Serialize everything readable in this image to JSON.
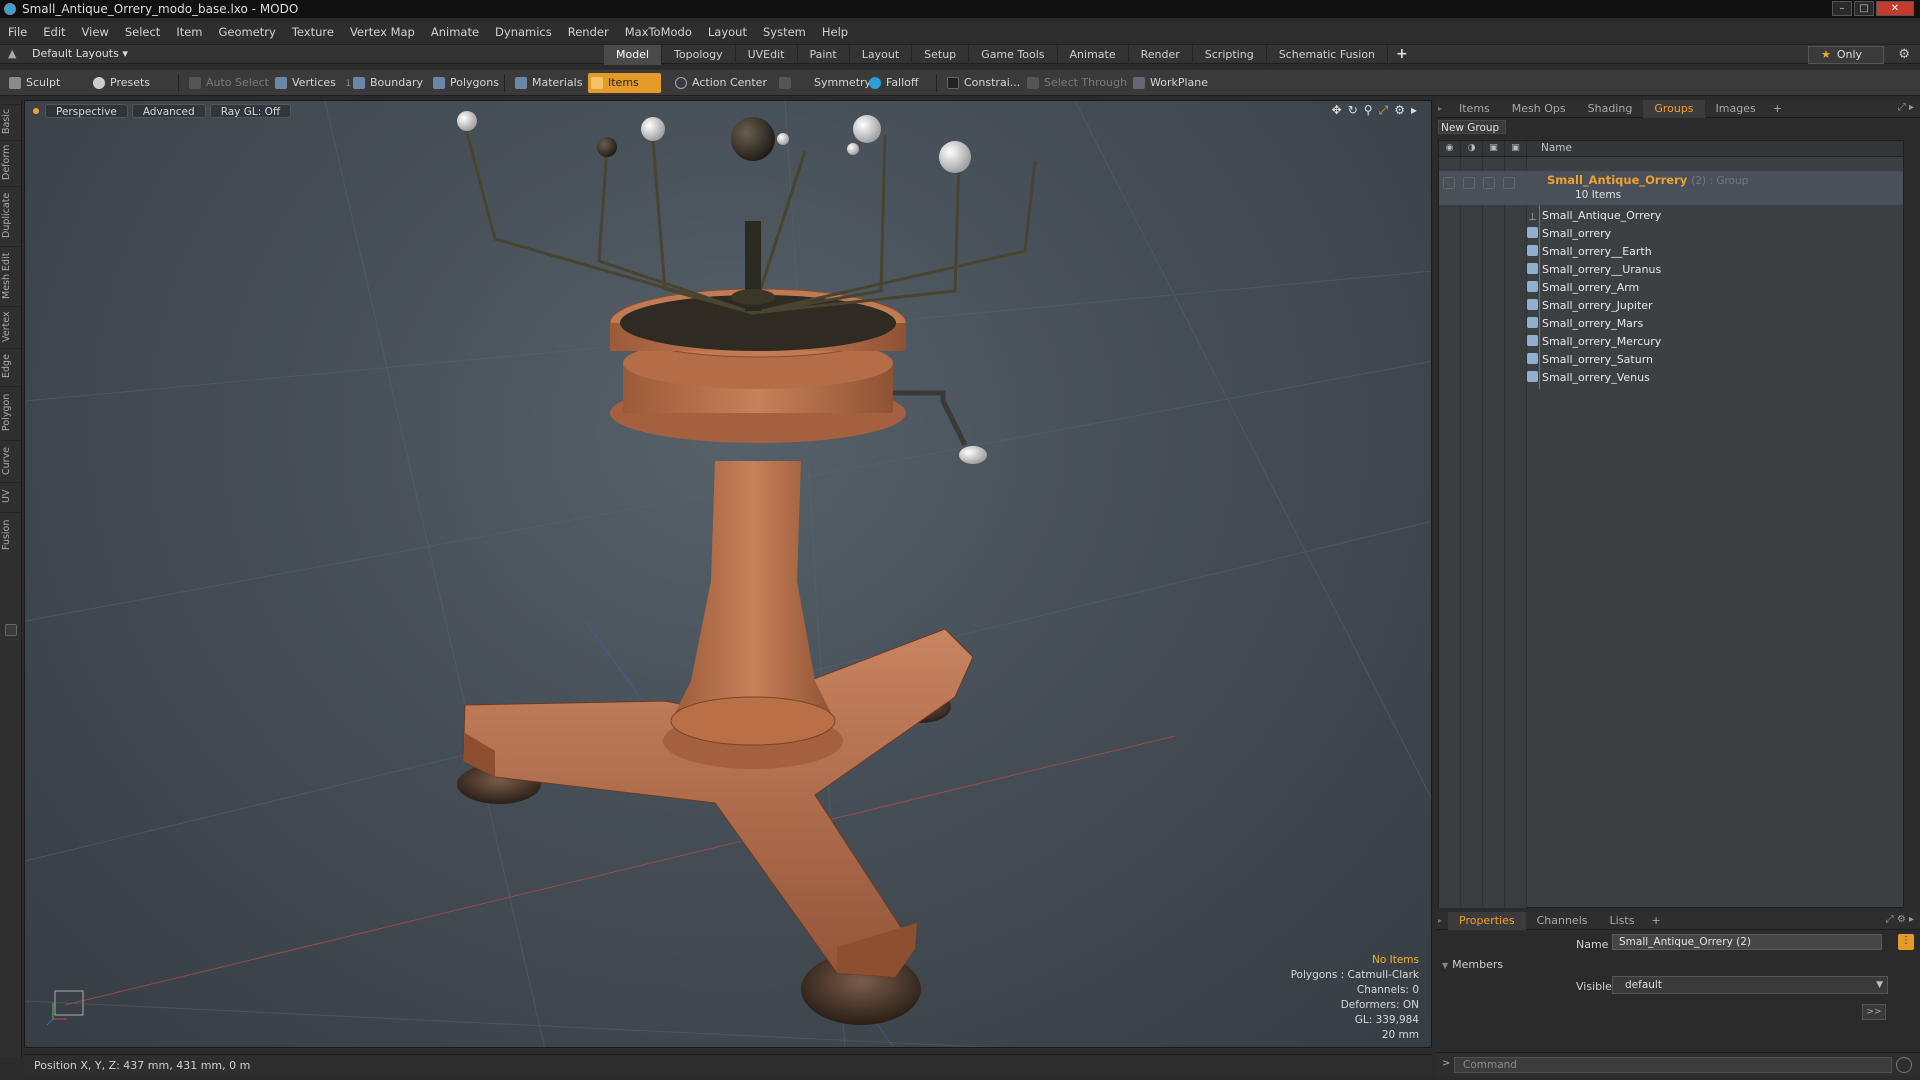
{
  "window": {
    "title": "Small_Antique_Orrery_modo_base.lxo - MODO"
  },
  "menu": [
    "File",
    "Edit",
    "View",
    "Select",
    "Item",
    "Geometry",
    "Texture",
    "Vertex Map",
    "Animate",
    "Dynamics",
    "Render",
    "MaxToModo",
    "Layout",
    "System",
    "Help"
  ],
  "layout": {
    "selector": "Default Layouts",
    "tabs": [
      "Model",
      "Topology",
      "UVEdit",
      "Paint",
      "Layout",
      "Setup",
      "Game Tools",
      "Animate",
      "Render",
      "Scripting",
      "Schematic Fusion"
    ],
    "active_tab": "Model",
    "only_label": "Only"
  },
  "toolbar": {
    "sculpt": "Sculpt",
    "presets": "Presets",
    "auto_select": "Auto Select",
    "vertices": "Vertices",
    "vertices_count": "1",
    "boundary": "Boundary",
    "polygons": "Polygons",
    "materials": "Materials",
    "items": "Items",
    "action_center": "Action Center",
    "symmetry": "Symmetry",
    "falloff": "Falloff",
    "constraints": "Constrai...",
    "select_through": "Select Through",
    "workplane": "WorkPlane"
  },
  "left_tabs": [
    "Basic",
    "Deform",
    "Duplicate",
    "Mesh Edit",
    "Vertex",
    "Edge",
    "Polygon",
    "Curve",
    "UV",
    "Fusion"
  ],
  "viewport": {
    "view": "Perspective",
    "mode": "Advanced",
    "raygl": "Ray GL: Off",
    "info": {
      "no_items": "No Items",
      "polygons": "Polygons : Catmull-Clark",
      "channels": "Channels: 0",
      "deformers": "Deformers: ON",
      "gl": "GL: 339,984",
      "scale": "20 mm"
    }
  },
  "status": {
    "position": "Position X, Y, Z:  437 mm, 431 mm, 0 m"
  },
  "panel_tabs": [
    "Items",
    "Mesh Ops",
    "Shading",
    "Groups",
    "Images"
  ],
  "panel_active": "Groups",
  "groups": {
    "new_group": "New Group",
    "name_header": "Name",
    "group_name": "Small_Antique_Orrery",
    "group_meta": "(2) : Group",
    "item_count": "10 Items",
    "items": [
      "Small_Antique_Orrery",
      "Small_orrery",
      "Small_orrery__Earth",
      "Small_orrery__Uranus",
      "Small_orrery_Arm",
      "Small_orrery_Jupiter",
      "Small_orrery_Mars",
      "Small_orrery_Mercury",
      "Small_orrery_Saturn",
      "Small_orrery_Venus"
    ]
  },
  "properties": {
    "tabs": [
      "Properties",
      "Channels",
      "Lists"
    ],
    "active": "Properties",
    "name_label": "Name",
    "name_value": "Small_Antique_Orrery (2)",
    "members_label": "Members",
    "visible_label": "Visible",
    "visible_value": "default",
    "more": ">>"
  },
  "command": {
    "placeholder": "Command"
  },
  "colors": {
    "accent": "#f0a030",
    "wood": "#b8734a",
    "viewport": "#454e56"
  }
}
